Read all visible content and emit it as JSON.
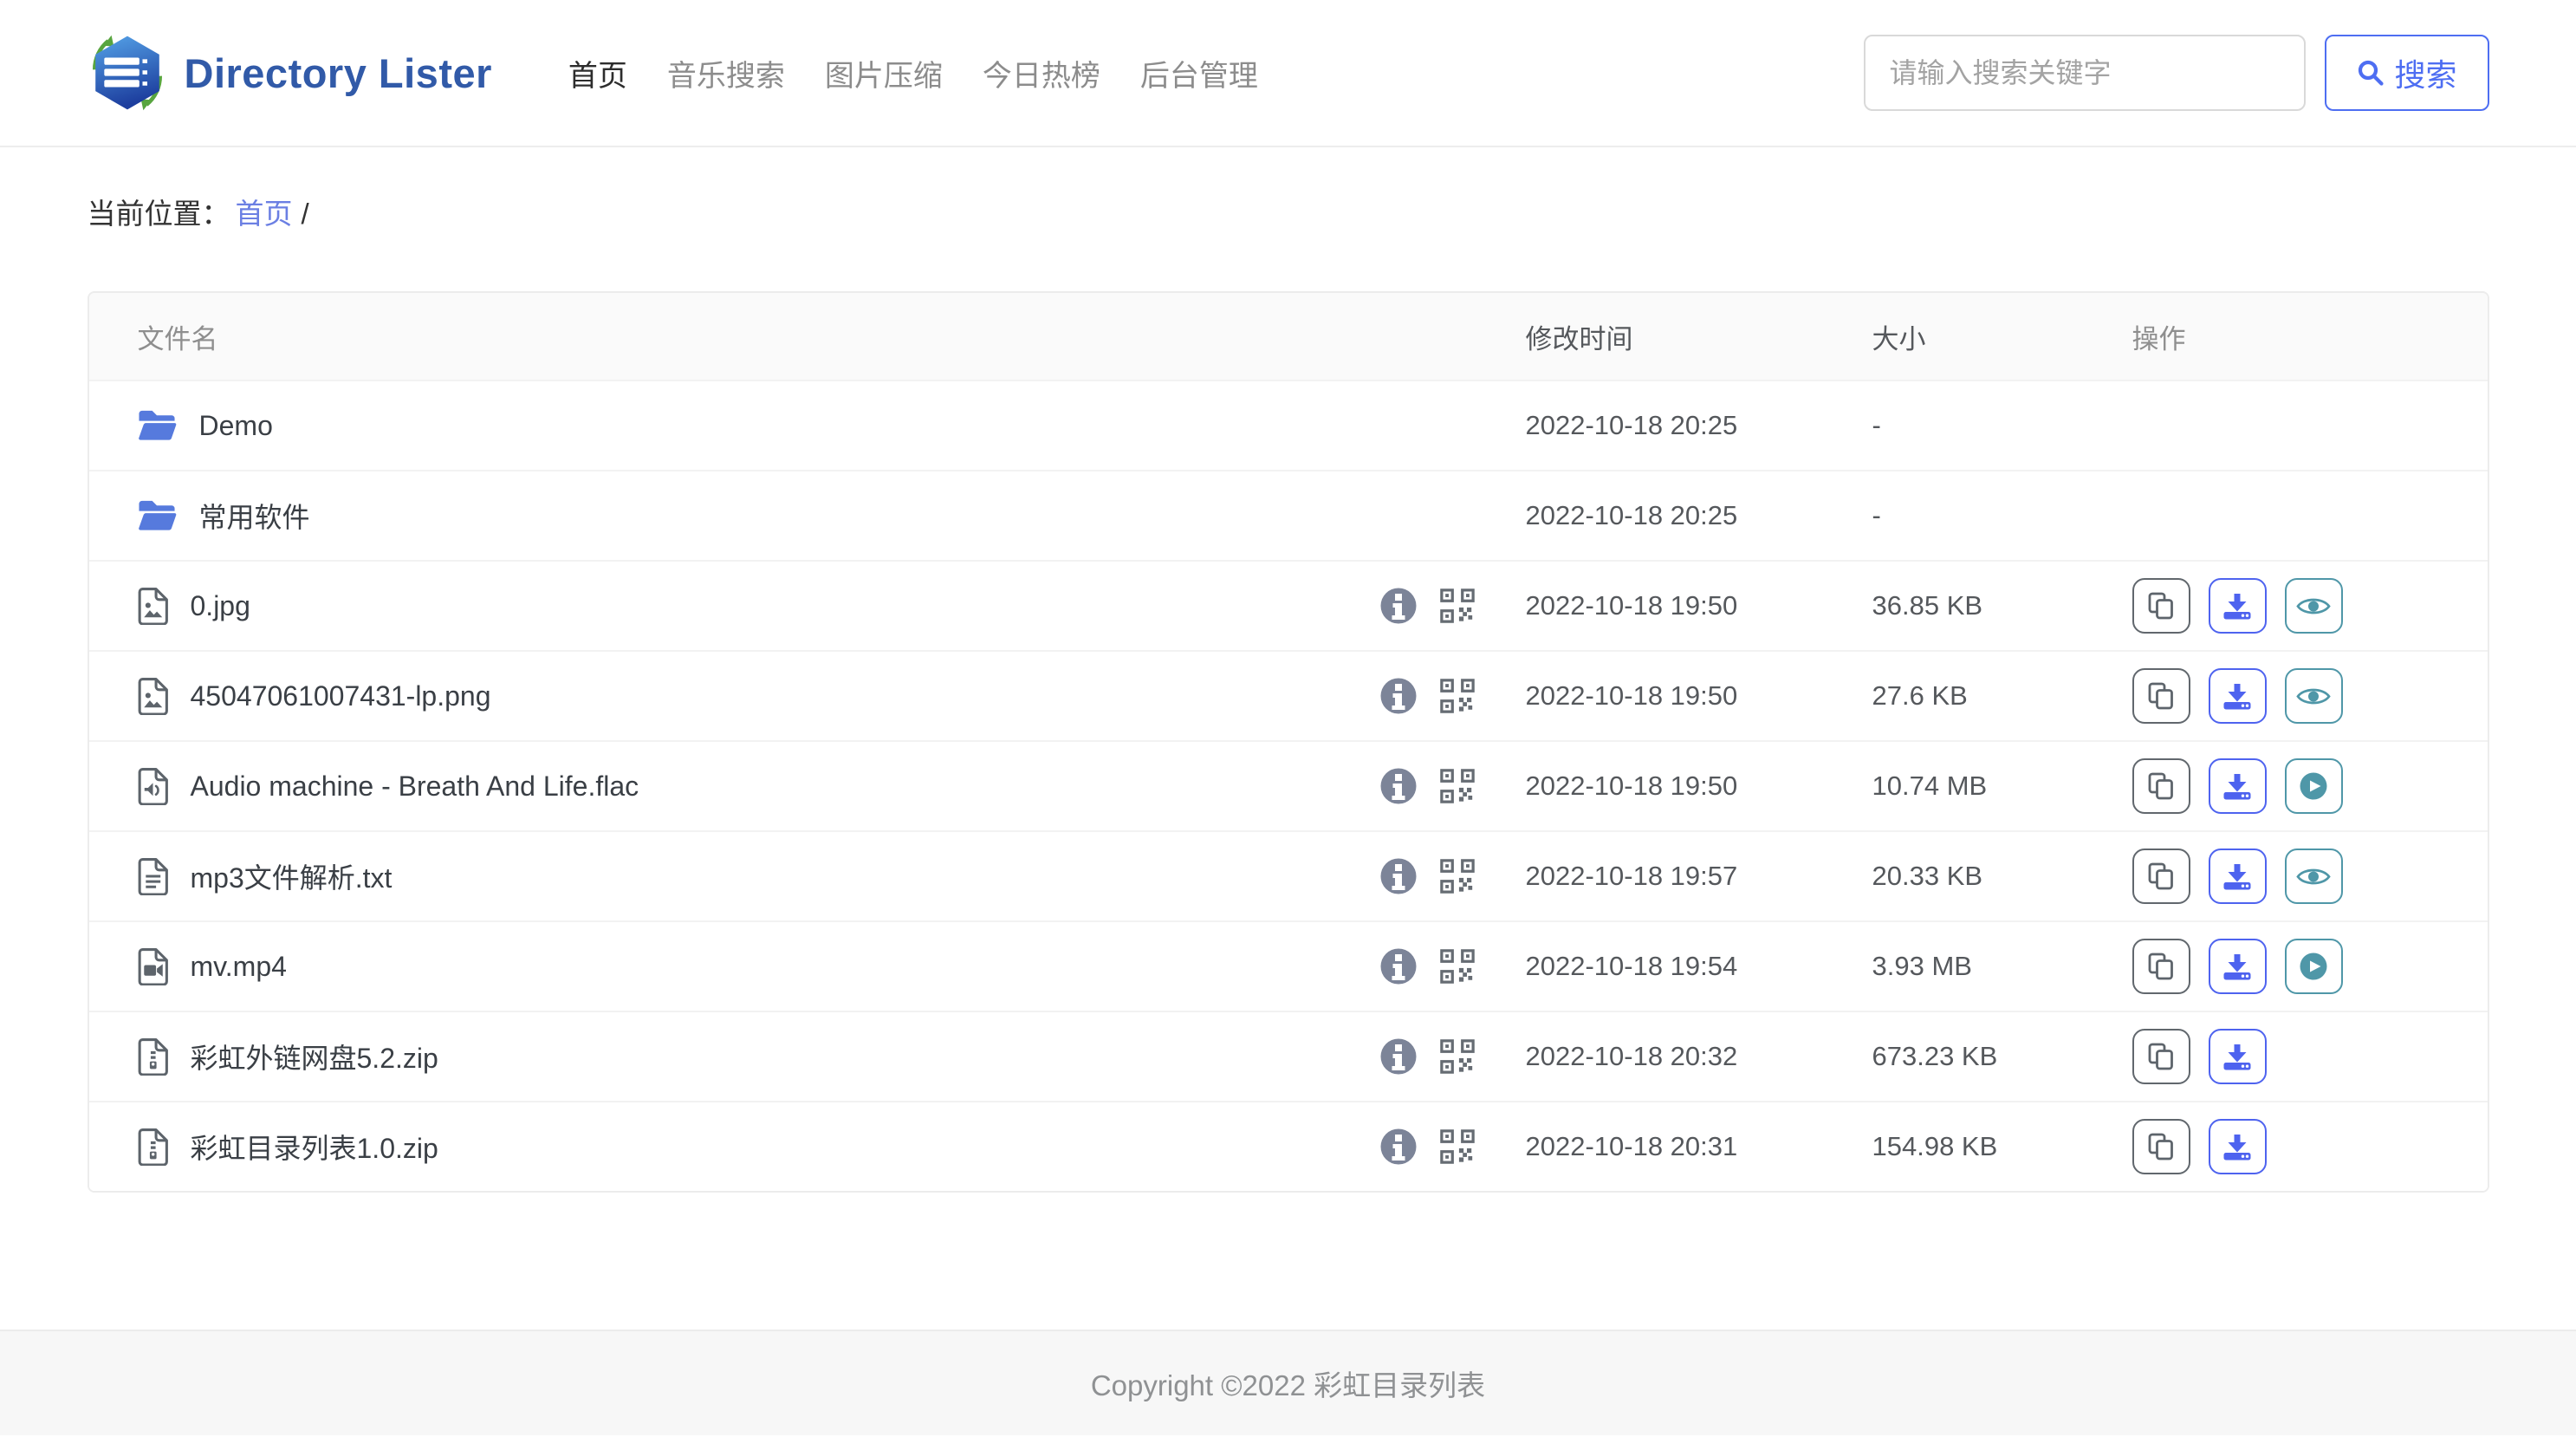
{
  "header": {
    "brand": "Directory Lister",
    "nav": [
      {
        "label": "首页",
        "active": true
      },
      {
        "label": "音乐搜索",
        "active": false
      },
      {
        "label": "图片压缩",
        "active": false
      },
      {
        "label": "今日热榜",
        "active": false
      },
      {
        "label": "后台管理",
        "active": false
      }
    ],
    "search": {
      "placeholder": "请输入搜索关键字",
      "button_label": "搜索"
    }
  },
  "breadcrumb": {
    "prefix": "当前位置：",
    "home": "首页",
    "separator": "/"
  },
  "table": {
    "columns": {
      "name": "文件名",
      "mtime": "修改时间",
      "size": "大小",
      "actions": "操作"
    },
    "rows": [
      {
        "name": "Demo",
        "type": "folder",
        "mtime": "2022-10-18 20:25",
        "size": "-",
        "actions": []
      },
      {
        "name": "常用软件",
        "type": "folder",
        "mtime": "2022-10-18 20:25",
        "size": "-",
        "actions": []
      },
      {
        "name": "0.jpg",
        "type": "image",
        "mtime": "2022-10-18 19:50",
        "size": "36.85 KB",
        "actions": [
          "copy",
          "download",
          "view"
        ]
      },
      {
        "name": "45047061007431-lp.png",
        "type": "image",
        "mtime": "2022-10-18 19:50",
        "size": "27.6 KB",
        "actions": [
          "copy",
          "download",
          "view"
        ]
      },
      {
        "name": "Audio machine - Breath And Life.flac",
        "type": "audio",
        "mtime": "2022-10-18 19:50",
        "size": "10.74 MB",
        "actions": [
          "copy",
          "download",
          "play"
        ]
      },
      {
        "name": "mp3文件解析.txt",
        "type": "text",
        "mtime": "2022-10-18 19:57",
        "size": "20.33 KB",
        "actions": [
          "copy",
          "download",
          "view"
        ]
      },
      {
        "name": "mv.mp4",
        "type": "video",
        "mtime": "2022-10-18 19:54",
        "size": "3.93 MB",
        "actions": [
          "copy",
          "download",
          "play"
        ]
      },
      {
        "name": "彩虹外链网盘5.2.zip",
        "type": "zip",
        "mtime": "2022-10-18 20:32",
        "size": "673.23 KB",
        "actions": [
          "copy",
          "download"
        ]
      },
      {
        "name": "彩虹目录列表1.0.zip",
        "type": "zip",
        "mtime": "2022-10-18 20:31",
        "size": "154.98 KB",
        "actions": [
          "copy",
          "download"
        ]
      }
    ]
  },
  "footer": {
    "copyright": "Copyright ©2022 彩虹目录列表"
  },
  "icons": {
    "logo": "hexagon-server-logo",
    "folder": "open-folder-icon",
    "image": "image-file-icon",
    "audio": "audio-file-icon",
    "text": "text-file-icon",
    "video": "video-file-icon",
    "zip": "zip-file-icon",
    "meta": [
      "info-icon",
      "qrcode-icon"
    ],
    "actions": [
      "copy-icon",
      "download-icon",
      "eye-icon",
      "play-icon"
    ],
    "search": "search-icon"
  },
  "colors": {
    "brand_text": "#315aa8",
    "primary_blue": "#4e6ef2",
    "download_blue": "#4e63ef",
    "teal": "#4f97a8",
    "folder_blue": "#567add",
    "link_blue": "#6b7fe3",
    "icon_gray": "#5d646b",
    "header_bg": "#fafafa",
    "footer_bg": "#f7f7f7"
  }
}
